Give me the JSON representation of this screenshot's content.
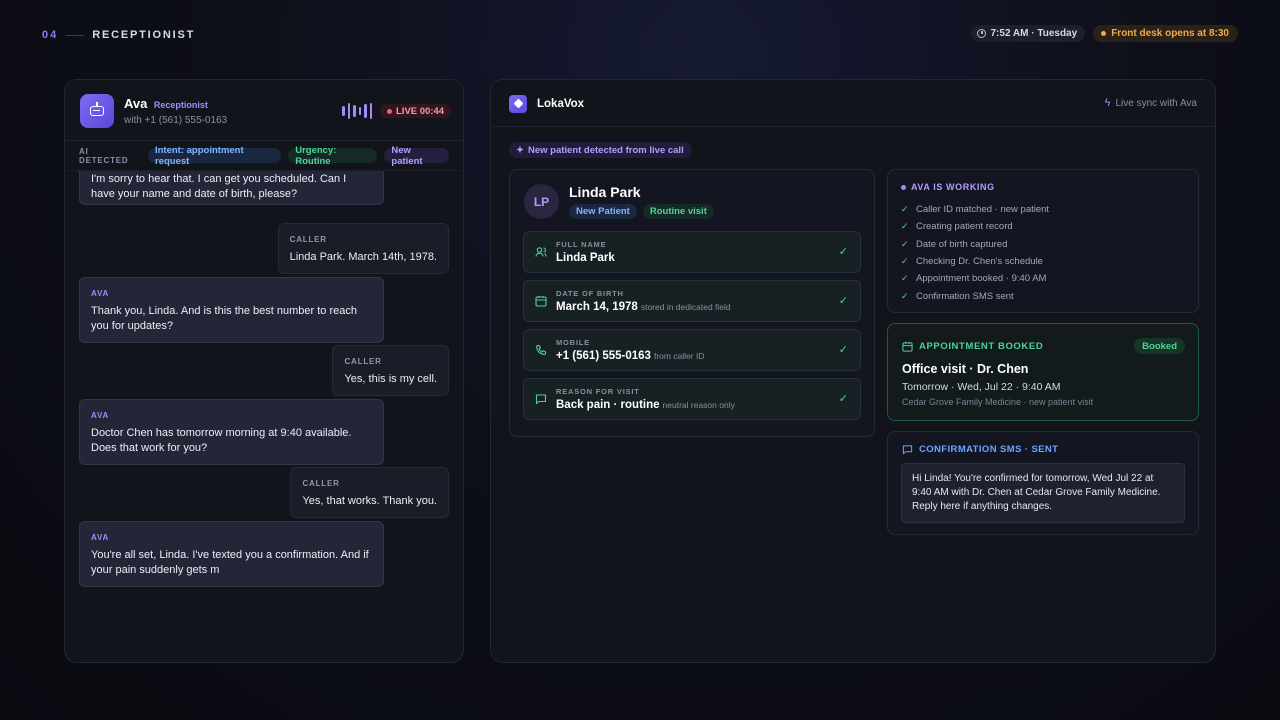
{
  "topbar": {
    "step": "04",
    "title": "RECEPTIONIST",
    "time": "7:52 AM · Tuesday",
    "desk": "Front desk opens at 8:30"
  },
  "call": {
    "agent_name": "Ava",
    "agent_role": "Receptionist",
    "caller_number": "with +1 (561) 555-0163",
    "live_label": "LIVE 00:44",
    "detected_label": "AI DETECTED",
    "tags": [
      "Intent: appointment request",
      "Urgency: Routine",
      "New patient"
    ],
    "messages": [
      {
        "who": "",
        "text": "I'm sorry to hear that. I can get you scheduled. Can I have your name and date of birth, please?"
      },
      {
        "who": "CALLER",
        "text": "Linda Park. March 14th, 1978."
      },
      {
        "who": "AVA",
        "text": "Thank you, Linda. And is this the best number to reach you for updates?"
      },
      {
        "who": "CALLER",
        "text": "Yes, this is my cell."
      },
      {
        "who": "AVA",
        "text": "Doctor Chen has tomorrow morning at 9:40 available. Does that work for you?"
      },
      {
        "who": "CALLER",
        "text": "Yes, that works. Thank you."
      },
      {
        "who": "AVA",
        "text": "You're all set, Linda. I've texted you a confirmation. And if your pain suddenly gets m"
      }
    ]
  },
  "app": {
    "brand": "LokaVox",
    "sync": "Live sync with Ava",
    "new_detect": "New patient detected from live call"
  },
  "patient": {
    "initials": "LP",
    "name": "Linda Park",
    "tags": [
      "New Patient",
      "Routine visit"
    ],
    "fields": [
      {
        "label": "FULL NAME",
        "value": "Linda Park",
        "note": ""
      },
      {
        "label": "DATE OF BIRTH",
        "value": "March 14, 1978",
        "note": "stored in dedicated field"
      },
      {
        "label": "MOBILE",
        "value": "+1 (561) 555-0163",
        "note": "from caller ID"
      },
      {
        "label": "REASON FOR VISIT",
        "value": "Back pain · routine",
        "note": "neutral reason only"
      }
    ]
  },
  "work": {
    "title": "AVA IS WORKING",
    "items": [
      "Caller ID matched · new patient",
      "Creating patient record",
      "Date of birth captured",
      "Checking Dr. Chen's schedule",
      "Appointment booked · 9:40 AM",
      "Confirmation SMS sent"
    ]
  },
  "appointment": {
    "title": "APPOINTMENT BOOKED",
    "status": "Booked",
    "heading": "Office visit · Dr. Chen",
    "when": "Tomorrow · Wed, Jul 22 · 9:40 AM",
    "where": "Cedar Grove Family Medicine · new patient visit"
  },
  "sms": {
    "title": "CONFIRMATION SMS · SENT",
    "body": "Hi Linda! You're confirmed for tomorrow, Wed Jul 22 at 9:40 AM with Dr. Chen at Cedar Grove Family Medicine. Reply here if anything changes."
  },
  "colors": {
    "accent": "#8b7cf6",
    "success": "#4cd39a",
    "live": "#f2636f",
    "warning": "#f2a94a",
    "info": "#6aa5ff"
  }
}
